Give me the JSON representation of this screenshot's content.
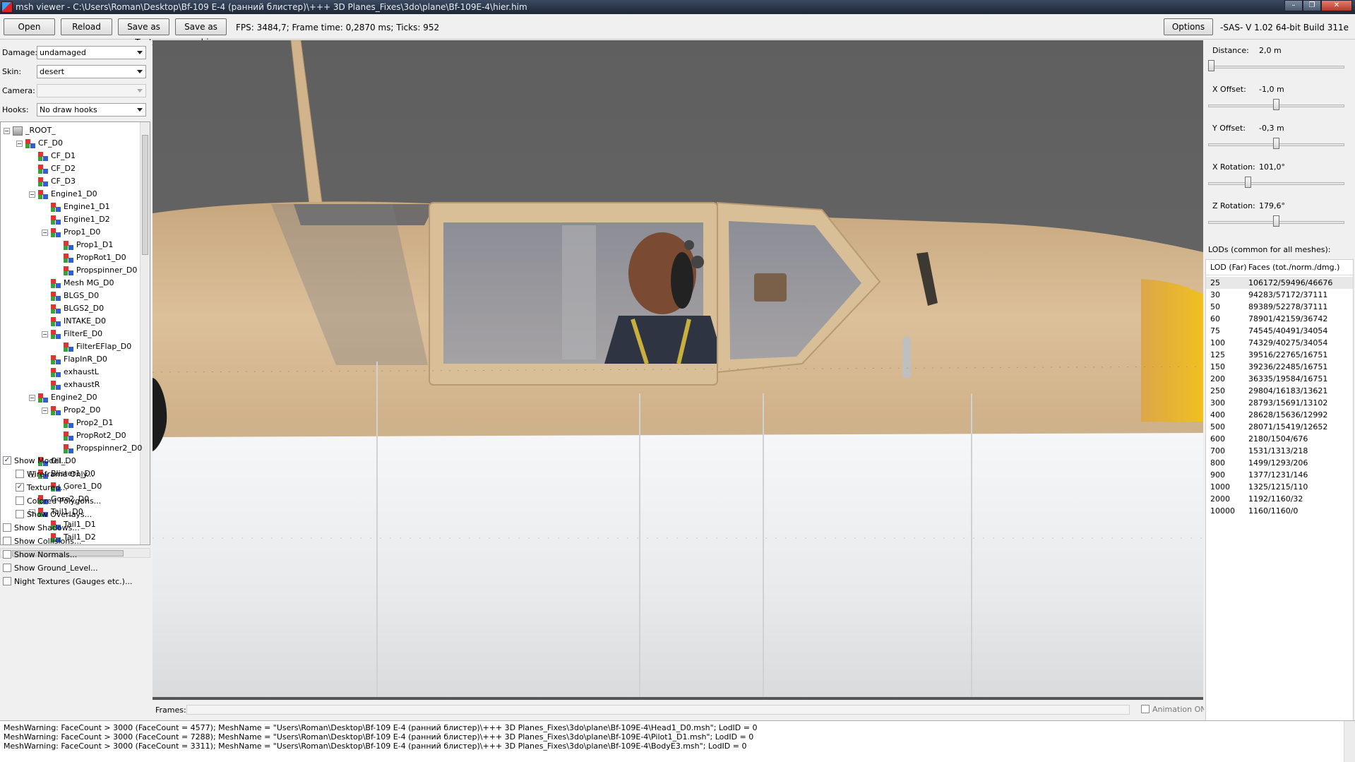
{
  "window": {
    "title": "msh viewer - C:\\Users\\Roman\\Desktop\\Bf-109 E-4 (ранний блистер)\\+++ 3D Planes_Fixes\\3do\\plane\\Bf-109E-4\\hier.him",
    "minimize": "–",
    "maximize": "❐",
    "close": "✕"
  },
  "toolbar": {
    "open": "Open",
    "reload": "Reload",
    "save_text": "Save as Text",
    "save_obj": "Save as .obj",
    "status": "FPS: 3484,7; Frame time: 0,2870 ms; Ticks: 952",
    "options": "Options",
    "version": "-SAS- V 1.02  64-bit  Build 311e"
  },
  "props": {
    "damage_label": "Damage:",
    "damage_value": "undamaged",
    "skin_label": "Skin:",
    "skin_value": "desert",
    "camera_label": "Camera:",
    "camera_value": "",
    "hooks_label": "Hooks:",
    "hooks_value": "No draw hooks"
  },
  "tree": [
    {
      "label": "_ROOT_",
      "level": 0,
      "expand": "−",
      "root": true
    },
    {
      "label": "CF_D0",
      "level": 1,
      "expand": "−"
    },
    {
      "label": "CF_D1",
      "level": 2,
      "expand": ""
    },
    {
      "label": "CF_D2",
      "level": 2,
      "expand": ""
    },
    {
      "label": "CF_D3",
      "level": 2,
      "expand": ""
    },
    {
      "label": "Engine1_D0",
      "level": 2,
      "expand": "−"
    },
    {
      "label": "Engine1_D1",
      "level": 3,
      "expand": ""
    },
    {
      "label": "Engine1_D2",
      "level": 3,
      "expand": ""
    },
    {
      "label": "Prop1_D0",
      "level": 3,
      "expand": "−"
    },
    {
      "label": "Prop1_D1",
      "level": 4,
      "expand": ""
    },
    {
      "label": "PropRot1_D0",
      "level": 4,
      "expand": ""
    },
    {
      "label": "Propspinner_D0",
      "level": 4,
      "expand": ""
    },
    {
      "label": "Mesh MG_D0",
      "level": 3,
      "expand": ""
    },
    {
      "label": "BLGS_D0",
      "level": 3,
      "expand": ""
    },
    {
      "label": "BLGS2_D0",
      "level": 3,
      "expand": ""
    },
    {
      "label": "INTAKE_D0",
      "level": 3,
      "expand": ""
    },
    {
      "label": "FilterE_D0",
      "level": 3,
      "expand": "−"
    },
    {
      "label": "FilterEFlap_D0",
      "level": 4,
      "expand": ""
    },
    {
      "label": "FlapInR_D0",
      "level": 3,
      "expand": ""
    },
    {
      "label": "exhaustL",
      "level": 3,
      "expand": ""
    },
    {
      "label": "exhaustR",
      "level": 3,
      "expand": ""
    },
    {
      "label": "Engine2_D0",
      "level": 2,
      "expand": "−"
    },
    {
      "label": "Prop2_D0",
      "level": 3,
      "expand": "−"
    },
    {
      "label": "Prop2_D1",
      "level": 4,
      "expand": ""
    },
    {
      "label": "PropRot2_D0",
      "level": 4,
      "expand": ""
    },
    {
      "label": "Propspinner2_D0",
      "level": 4,
      "expand": ""
    },
    {
      "label": "Oil_D0",
      "level": 2,
      "expand": ""
    },
    {
      "label": "Blister1_D0",
      "level": 2,
      "expand": "−"
    },
    {
      "label": "Gore1_D0",
      "level": 3,
      "expand": ""
    },
    {
      "label": "Gore2_D0",
      "level": 2,
      "expand": ""
    },
    {
      "label": "Tail1_D0",
      "level": 2,
      "expand": "−"
    },
    {
      "label": "Tail1_D1",
      "level": 3,
      "expand": ""
    },
    {
      "label": "Tail1_D2",
      "level": 3,
      "expand": ""
    }
  ],
  "checkboxes": [
    {
      "label": "Show Model...",
      "checked": true,
      "indent": 0
    },
    {
      "label": "Wireframe Only...",
      "checked": false,
      "indent": 1
    },
    {
      "label": "Textured...",
      "checked": true,
      "indent": 1
    },
    {
      "label": "Colored Polygons...",
      "checked": false,
      "indent": 1
    },
    {
      "label": "Show Overlays...",
      "checked": false,
      "indent": 1
    },
    {
      "label": "Show Shadows...",
      "checked": false,
      "indent": 0
    },
    {
      "label": "Show Collisions...",
      "checked": false,
      "indent": 0
    },
    {
      "label": "Show Normals...",
      "checked": false,
      "indent": 0
    },
    {
      "label": "Show Ground_Level...",
      "checked": false,
      "indent": 0
    },
    {
      "label": "Night Textures (Gauges etc.)...",
      "checked": false,
      "indent": 0
    }
  ],
  "frames": {
    "label": "Frames:",
    "animation": "Animation ON"
  },
  "sliders": [
    {
      "label": "Distance:",
      "value": "2,0 m",
      "position": 0.0
    },
    {
      "label": "X Offset:",
      "value": "-1,0 m",
      "position": 0.5
    },
    {
      "label": "Y Offset:",
      "value": "-0,3 m",
      "position": 0.5
    },
    {
      "label": "X Rotation:",
      "value": "101,0°",
      "position": 0.28
    },
    {
      "label": "Z Rotation:",
      "value": "179,6°",
      "position": 0.5
    }
  ],
  "lods": {
    "title": "LODs (common for all meshes):",
    "col_lod": "LOD (Far)",
    "col_faces": "Faces (tot./norm./dmg.)",
    "rows": [
      {
        "lod": "25",
        "faces": "106172/59496/46676"
      },
      {
        "lod": "30",
        "faces": "94283/57172/37111"
      },
      {
        "lod": "50",
        "faces": "89389/52278/37111"
      },
      {
        "lod": "60",
        "faces": "78901/42159/36742"
      },
      {
        "lod": "75",
        "faces": "74545/40491/34054"
      },
      {
        "lod": "100",
        "faces": "74329/40275/34054"
      },
      {
        "lod": "125",
        "faces": "39516/22765/16751"
      },
      {
        "lod": "150",
        "faces": "39236/22485/16751"
      },
      {
        "lod": "200",
        "faces": "36335/19584/16751"
      },
      {
        "lod": "250",
        "faces": "29804/16183/13621"
      },
      {
        "lod": "300",
        "faces": "28793/15691/13102"
      },
      {
        "lod": "400",
        "faces": "28628/15636/12992"
      },
      {
        "lod": "500",
        "faces": "28071/15419/12652"
      },
      {
        "lod": "600",
        "faces": "2180/1504/676"
      },
      {
        "lod": "700",
        "faces": "1531/1313/218"
      },
      {
        "lod": "800",
        "faces": "1499/1293/206"
      },
      {
        "lod": "900",
        "faces": "1377/1231/146"
      },
      {
        "lod": "1000",
        "faces": "1325/1215/110"
      },
      {
        "lod": "2000",
        "faces": "1192/1160/32"
      },
      {
        "lod": "10000",
        "faces": "1160/1160/0"
      }
    ]
  },
  "log": [
    "MeshWarning: FaceCount > 3000 (FaceCount = 4577); MeshName = \"Users\\Roman\\Desktop\\Bf-109 E-4 (ранний блистер)\\+++ 3D Planes_Fixes\\3do\\plane\\Bf-109E-4\\Head1_D0.msh\"; LodID = 0",
    "MeshWarning: FaceCount > 3000 (FaceCount = 7288); MeshName = \"Users\\Roman\\Desktop\\Bf-109 E-4 (ранний блистер)\\+++ 3D Planes_Fixes\\3do\\plane\\Bf-109E-4\\Pilot1_D1.msh\"; LodID = 0",
    "MeshWarning: FaceCount > 3000 (FaceCount = 3311); MeshName = \"Users\\Roman\\Desktop\\Bf-109 E-4 (ранний блистер)\\+++ 3D Planes_Fixes\\3do\\plane\\Bf-109E-4\\BodyE3.msh\"; LodID = 0"
  ],
  "colors": {
    "fuselage_tan": "#d6b88f",
    "fuselage_white": "#eceeef",
    "background_grey": "#646464",
    "nose_yellow": "#e8b82a"
  }
}
